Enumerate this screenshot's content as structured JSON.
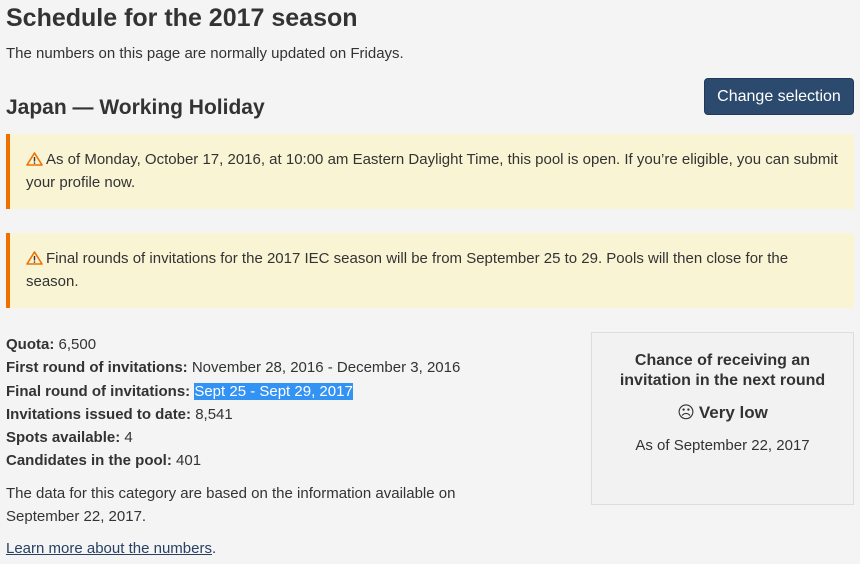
{
  "page": {
    "title": "Schedule for the 2017 season",
    "intro": "The numbers on this page are normally updated on Fridays."
  },
  "section": {
    "title": "Japan — Working Holiday",
    "change_button": "Change selection"
  },
  "alerts": [
    {
      "icon": "warning-icon",
      "text": "As of Monday, October 17, 2016, at 10:00 am Eastern Daylight Time, this pool is open. If you’re eligible, you can submit your profile now."
    },
    {
      "icon": "warning-icon",
      "text": "Final rounds of invitations for the 2017 IEC season will be from September 25 to 29. Pools will then close for the season."
    }
  ],
  "facts": {
    "quota": {
      "label": "Quota:",
      "value": "6,500"
    },
    "first_round": {
      "label": "First round of invitations:",
      "value": "November 28, 2016 - December 3, 2016"
    },
    "final_round": {
      "label": "Final round of invitations:",
      "value": "Sept 25 - Sept 29, 2017"
    },
    "issued": {
      "label": "Invitations issued to date:",
      "value": "8,541"
    },
    "spots": {
      "label": "Spots available:",
      "value": "4"
    },
    "candidates": {
      "label": "Candidates in the pool:",
      "value": "401"
    }
  },
  "data_note": "The data for this category are based on the information available on September 22, 2017.",
  "learn_more": {
    "text": "Learn more about the numbers",
    "suffix": "."
  },
  "chance": {
    "title": "Chance of receiving an invitation in the next round",
    "face": "☹",
    "value": "Very low",
    "as_of": "As of September 22, 2017"
  },
  "colors": {
    "background": "#f4f4f4",
    "button": "#2b4a6e",
    "alert_bg": "#f9f4d4",
    "alert_border": "#ee7100",
    "highlight": "#3393f5"
  }
}
